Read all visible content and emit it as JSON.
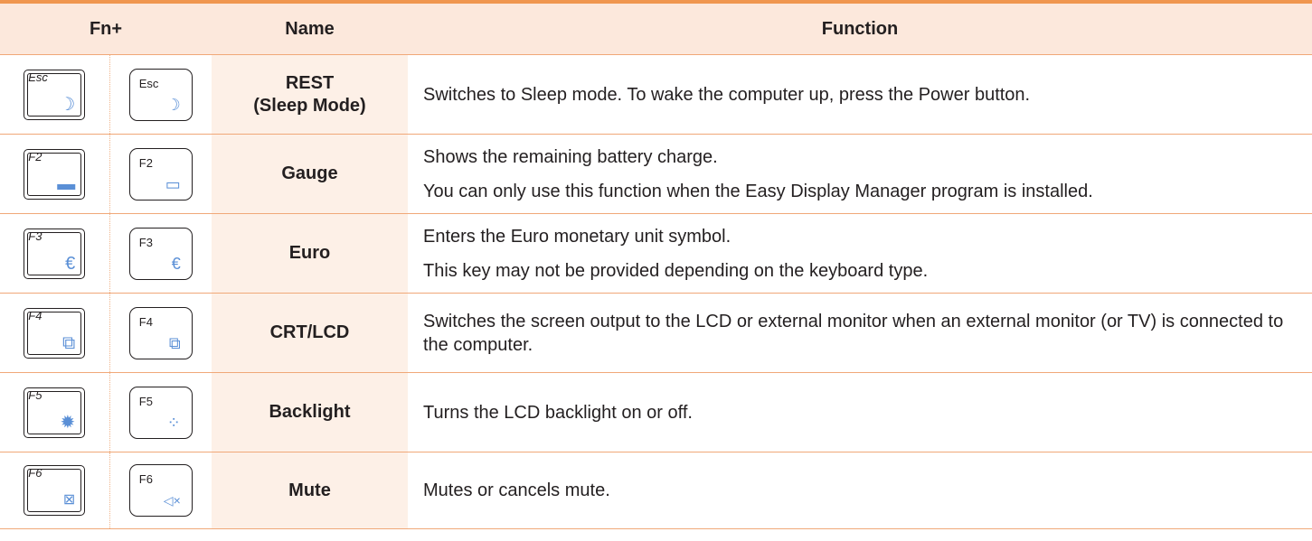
{
  "header": {
    "col_fn": "Fn+",
    "col_name": "Name",
    "col_function": "Function"
  },
  "rows": [
    {
      "key_a": "Esc",
      "key_b": "Esc",
      "icon": "moon-icon",
      "glyph": "☽",
      "name_lines": [
        "REST",
        "(Sleep Mode)"
      ],
      "function_lines": [
        "Switches to Sleep mode. To wake the computer up, press the Power button."
      ]
    },
    {
      "key_a": "F2",
      "key_b": "F2",
      "icon": "battery-icon",
      "glyph": "▭",
      "name_lines": [
        "Gauge"
      ],
      "function_lines": [
        "Shows the remaining battery charge.",
        "You can only use this function when the Easy Display Manager program is installed."
      ]
    },
    {
      "key_a": "F3",
      "key_b": "F3",
      "icon": "euro-icon",
      "glyph": "€",
      "name_lines": [
        "Euro"
      ],
      "function_lines": [
        "Enters the Euro monetary unit symbol.",
        "This key may not be provided depending on the keyboard type."
      ]
    },
    {
      "key_a": "F4",
      "key_b": "F4",
      "icon": "monitor-switch-icon",
      "glyph": "⧉",
      "name_lines": [
        "CRT/LCD"
      ],
      "function_lines": [
        "Switches the screen output to the LCD or external monitor when an external monitor (or TV) is connected to the computer."
      ]
    },
    {
      "key_a": "F5",
      "key_b": "F5",
      "icon": "backlight-icon",
      "glyph": "✳",
      "name_lines": [
        "Backlight"
      ],
      "function_lines": [
        "Turns the LCD backlight on or off."
      ]
    },
    {
      "key_a": "F6",
      "key_b": "F6",
      "icon": "mute-icon",
      "glyph": "🔇",
      "name_lines": [
        "Mute"
      ],
      "function_lines": [
        "Mutes or cancels mute."
      ]
    }
  ],
  "colors": {
    "accent": "#f0964f",
    "header_bg": "#fce8dc",
    "name_bg": "#fdf0e7",
    "icon": "#5a8fd6"
  }
}
